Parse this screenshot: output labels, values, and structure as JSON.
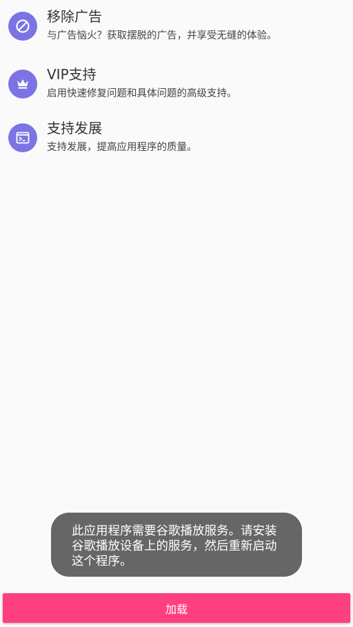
{
  "features": [
    {
      "icon": "block-icon",
      "title": "移除广告",
      "description": "与广告恼火？获取摆脱的广告，并享受无缝的体验。"
    },
    {
      "icon": "crown-icon",
      "title": "VIP支持",
      "description": "启用快速修复问题和具体问题的高级支持。"
    },
    {
      "icon": "terminal-icon",
      "title": "支持发展",
      "description": "支持发展，提高应用程序的质量。"
    }
  ],
  "toast": {
    "message": "此应用程序需要谷歌播放服务。请安装谷歌播放设备上的服务，然后重新启动这个程序。"
  },
  "button": {
    "label": "加载"
  },
  "colors": {
    "background": "#fafafa",
    "icon_circle": "#7c74e4",
    "toast_background": "#666666",
    "button_background": "#ff407f"
  }
}
